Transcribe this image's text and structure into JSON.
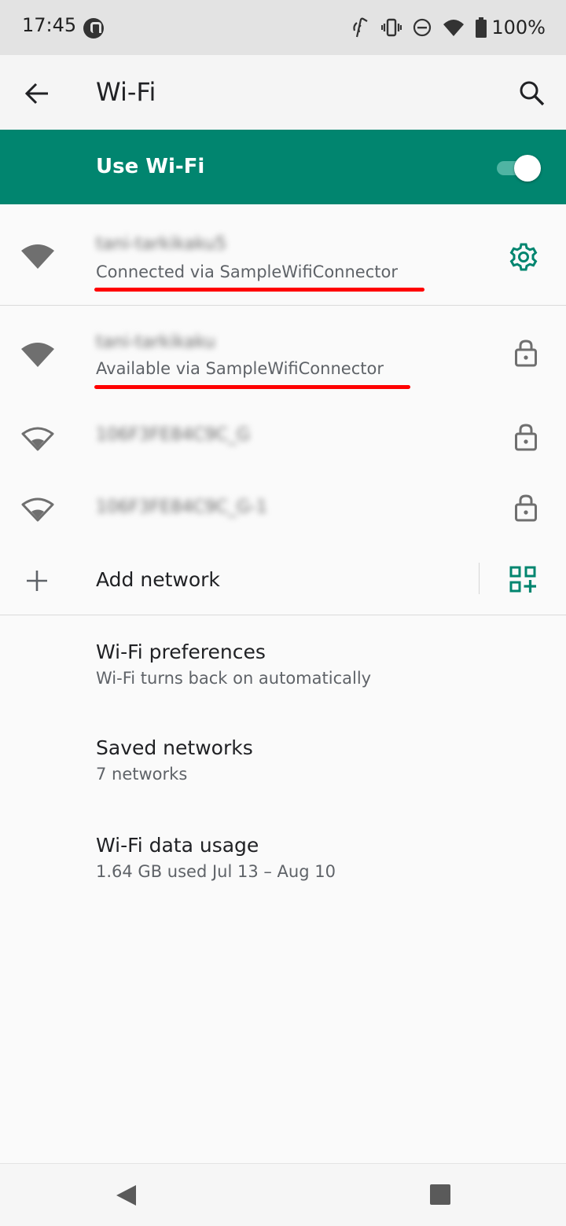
{
  "status_bar": {
    "time": "17:45",
    "battery": "100%",
    "icons": [
      "app-icon",
      "nfc-icon",
      "vibrate-icon",
      "do-not-disturb-icon",
      "wifi-signal-icon",
      "battery-icon"
    ]
  },
  "app_bar": {
    "title": "Wi-Fi",
    "back_icon": "arrow-back-icon",
    "search_icon": "search-icon"
  },
  "master_switch": {
    "label": "Use Wi-Fi",
    "enabled": true,
    "background": "#01856f"
  },
  "networks": [
    {
      "ssid": "tani-tarkikaku5",
      "status": "Connected via SampleWifiConnector",
      "signal": "full",
      "trailing": "gear-icon"
    },
    {
      "ssid": "tani-tarkikaku",
      "status": "Available via SampleWifiConnector",
      "signal": "full",
      "trailing": "lock-icon"
    },
    {
      "ssid": "106F3FE84C9C_G",
      "status": "",
      "signal": "outline",
      "trailing": "lock-icon"
    },
    {
      "ssid": "106F3FE84C9C_G-1",
      "status": "",
      "signal": "outline",
      "trailing": "lock-icon"
    }
  ],
  "add_network": {
    "label": "Add network",
    "icon": "plus-icon",
    "qr_icon": "qr-code-icon"
  },
  "settings": [
    {
      "title": "Wi-Fi preferences",
      "subtitle": "Wi-Fi turns back on automatically"
    },
    {
      "title": "Saved networks",
      "subtitle": "7 networks"
    },
    {
      "title": "Wi-Fi data usage",
      "subtitle": "1.64 GB used Jul 13 – Aug 10"
    }
  ],
  "nav_bar": {
    "back_icon": "nav-back-icon",
    "recents_icon": "nav-recents-icon"
  },
  "colors": {
    "accent": "#01856f",
    "annotation": "#ff0000"
  }
}
